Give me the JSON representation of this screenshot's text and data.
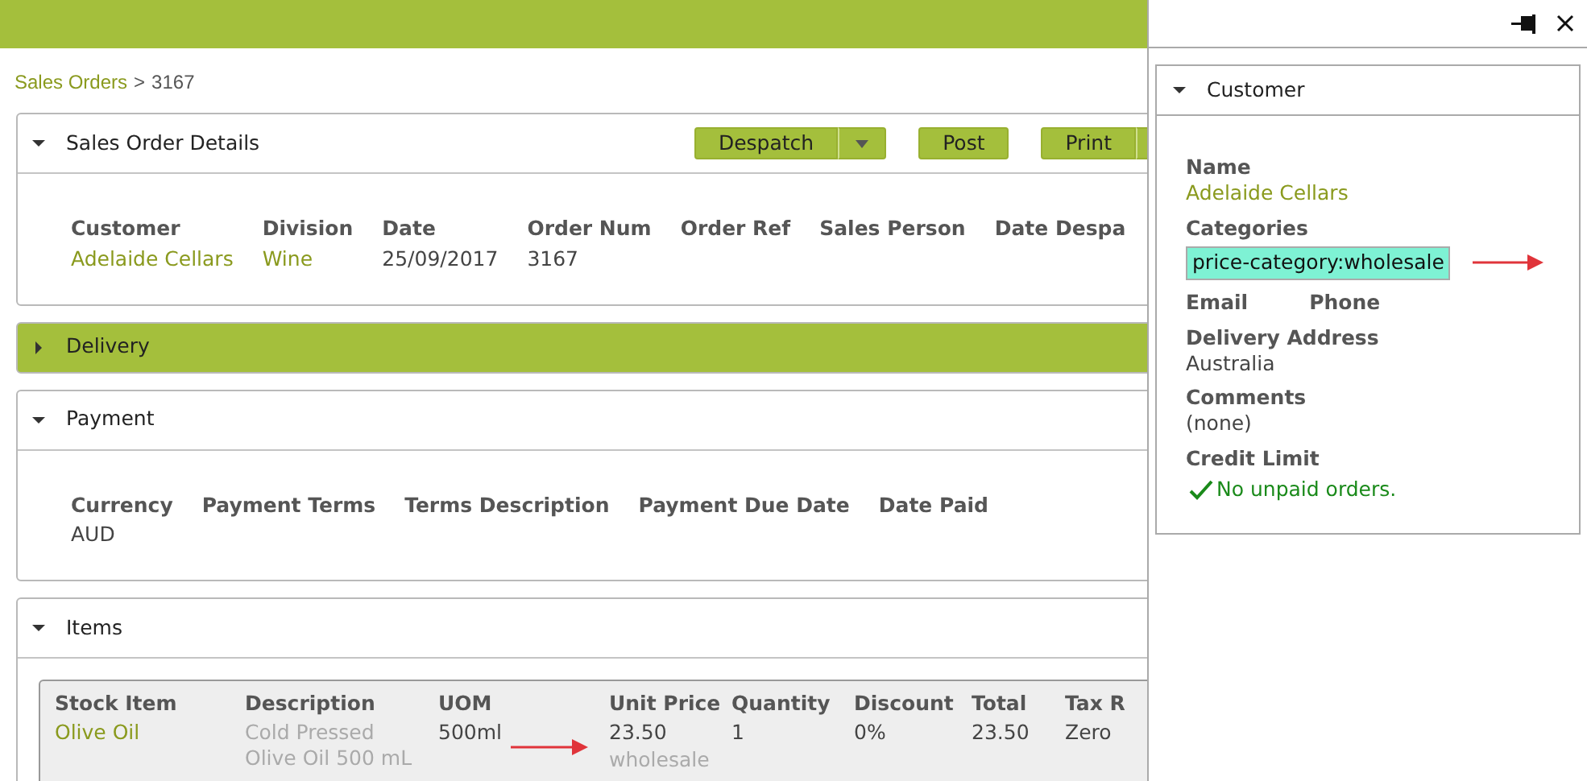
{
  "breadcrumb": {
    "link": "Sales Orders",
    "separator": ">",
    "current": "3167"
  },
  "sections": [
    {
      "kind": "fields",
      "title": "Sales Order Details",
      "expanded": true,
      "buttons": [
        {
          "label": "Despatch",
          "has_menu": true
        },
        {
          "label": "Post",
          "has_menu": false
        },
        {
          "label": "Print",
          "has_menu": true
        }
      ],
      "fields": [
        {
          "label": "Customer",
          "value": "Adelaide Cellars",
          "kind": "link"
        },
        {
          "label": "Division",
          "value": "Wine",
          "kind": "link"
        },
        {
          "label": "Date",
          "value": "25/09/2017",
          "kind": "text"
        },
        {
          "label": "Order Num",
          "value": "3167",
          "kind": "text"
        },
        {
          "label": "Order Ref"
        },
        {
          "label": "Sales Person"
        },
        {
          "label": "Date Despa"
        }
      ]
    },
    {
      "title": "Delivery",
      "expanded": false
    },
    {
      "kind": "fields",
      "title": "Payment",
      "expanded": true,
      "fields": [
        {
          "label": "Currency",
          "value": "AUD",
          "kind": "text"
        },
        {
          "label": "Payment Terms"
        },
        {
          "label": "Terms Description"
        },
        {
          "label": "Payment Due Date"
        },
        {
          "label": "Date Paid"
        }
      ]
    },
    {
      "kind": "items",
      "title": "Items",
      "expanded": true,
      "columns": [
        "Stock Item",
        "Description",
        "UOM",
        "Unit Price",
        "Quantity",
        "Discount",
        "Total",
        "Tax R"
      ],
      "rows": [
        [
          {
            "value": "Olive Oil",
            "kind": "link"
          },
          {
            "value": "Cold Pressed Olive Oil 500 mL",
            "kind": "muted"
          },
          {
            "value": "500ml",
            "kind": "text"
          },
          {
            "value": "23.50",
            "kind": "text",
            "note": "wholesale"
          },
          {
            "value": "1",
            "kind": "text"
          },
          {
            "value": "0%",
            "kind": "text"
          },
          {
            "value": "23.50",
            "kind": "text"
          },
          {
            "value": "Zero",
            "kind": "text"
          }
        ]
      ]
    }
  ],
  "panel": {
    "title": "Customer",
    "expanded": true,
    "fields": [
      {
        "kind": "link",
        "label": "Name",
        "value": "Adelaide Cellars"
      },
      {
        "kind": "tag",
        "label": "Categories",
        "value": "price-category:wholesale"
      },
      {
        "kind": "pair",
        "label": "Email",
        "label2": "Phone"
      },
      {
        "kind": "text",
        "label": "Delivery Address",
        "value": "Australia"
      },
      {
        "kind": "text",
        "label": "Comments",
        "value": "(none)"
      },
      {
        "kind": "status",
        "label": "Credit Limit",
        "value": "No unpaid orders."
      }
    ]
  }
}
